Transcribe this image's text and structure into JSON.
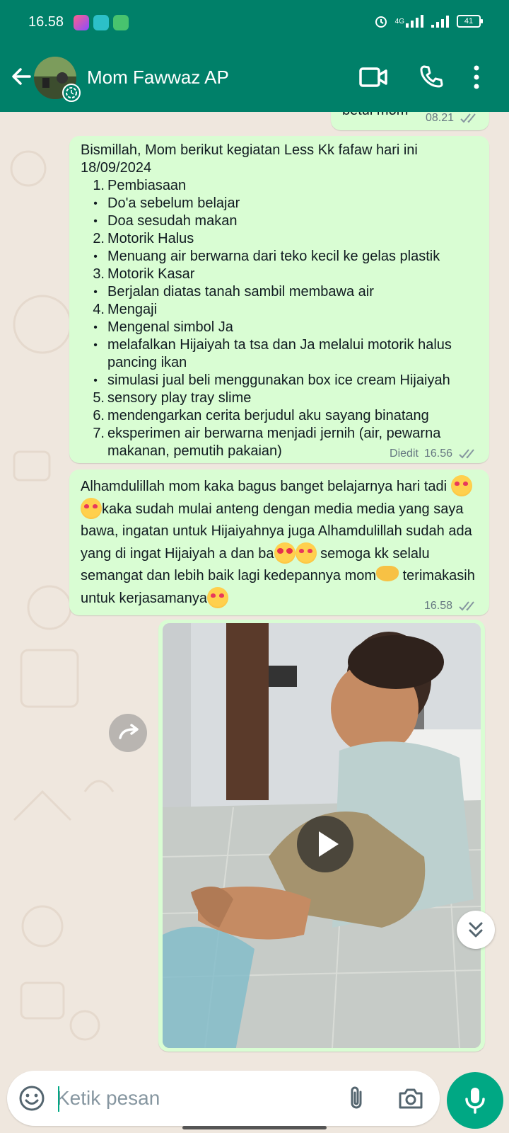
{
  "status_bar": {
    "time": "16.58",
    "network": "4G",
    "battery": "41"
  },
  "header": {
    "contact_name": "Mom Fawwaz AP"
  },
  "messages": [
    {
      "text": "betul mom",
      "time": "08.21"
    },
    {
      "intro": "Bismillah, Mom berikut kegiatan Less Kk fafaw hari ini 18/09/2024",
      "items": [
        {
          "mark": "1.",
          "text": "Pembiasaan"
        },
        {
          "mark": "•",
          "text": "Do'a sebelum belajar"
        },
        {
          "mark": "•",
          "text": "Doa sesudah makan"
        },
        {
          "mark": "2.",
          "text": "Motorik Halus"
        },
        {
          "mark": "•",
          "text": "Menuang air berwarna dari teko kecil ke gelas plastik"
        },
        {
          "mark": "3.",
          "text": "Motorik Kasar"
        },
        {
          "mark": "•",
          "text": "Berjalan diatas tanah sambil membawa air"
        },
        {
          "mark": "4.",
          "text": "Mengaji"
        },
        {
          "mark": "•",
          "text": "Mengenal simbol Ja"
        },
        {
          "mark": "•",
          "text": "melafalkan Hijaiyah ta tsa dan Ja melalui motorik halus pancing ikan"
        },
        {
          "mark": "•",
          "text": "simulasi jual beli menggunakan box ice cream Hijaiyah"
        },
        {
          "mark": "5.",
          "text": "sensory play tray slime"
        },
        {
          "mark": "6.",
          "text": "mendengarkan cerita berjudul aku sayang binatang"
        },
        {
          "mark": "7.",
          "text": "eksperimen air berwarna menjadi jernih (air, pewarna makanan, pemutih pakaian)"
        }
      ],
      "edited_label": "Diedit",
      "time": "16.56"
    },
    {
      "part1": "Alhamdulillah mom kaka bagus banget belajarnya hari tadi",
      "part2": "kaka sudah mulai anteng dengan media media yang saya bawa, ingatan untuk Hijaiyahnya juga Alhamdulillah sudah ada yang di ingat Hijaiyah a dan ba",
      "part3": " semoga kk selalu semangat dan lebih baik lagi kedepannya mom",
      "part4": "terimakasih untuk kerjasamanya",
      "time": "16.58"
    }
  ],
  "composer": {
    "placeholder": "Ketik pesan"
  },
  "colors": {
    "header": "#008069",
    "outgoing_bubble": "#d9fdd3",
    "chat_background": "#efe7de",
    "accent": "#00a884"
  },
  "icons": [
    "back-arrow-icon",
    "video-call-icon",
    "phone-icon",
    "more-vert-icon",
    "emoji-icon",
    "attach-icon",
    "camera-icon",
    "mic-icon",
    "forward-icon",
    "play-icon",
    "chevron-double-down-icon"
  ]
}
